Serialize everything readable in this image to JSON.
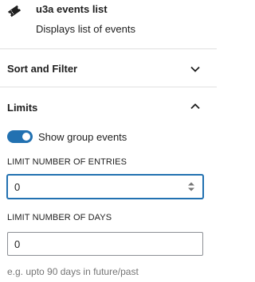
{
  "block": {
    "icon": "ticket-icon",
    "title": "u3a events list",
    "description": "Displays list of events"
  },
  "panels": {
    "sort_filter": {
      "title": "Sort and Filter",
      "icon": "chevron-down-icon",
      "expanded": false
    },
    "limits": {
      "title": "Limits",
      "icon": "chevron-up-icon",
      "expanded": true
    }
  },
  "limits": {
    "toggle": {
      "label": "Show group events",
      "checked": true,
      "color": "#2271b1"
    },
    "limit_entries": {
      "label": "LIMIT NUMBER OF ENTRIES",
      "value": "0",
      "focused": true,
      "spinner_icon": "spinner-arrows-icon"
    },
    "limit_days": {
      "label": "LIMIT NUMBER OF DAYS",
      "value": "0"
    },
    "help": "e.g. upto 90 days in future/past"
  },
  "colors": {
    "accent": "#2271b1",
    "divider": "#e0e0e0",
    "help_text": "#757575",
    "text": "#1e1e1e"
  }
}
